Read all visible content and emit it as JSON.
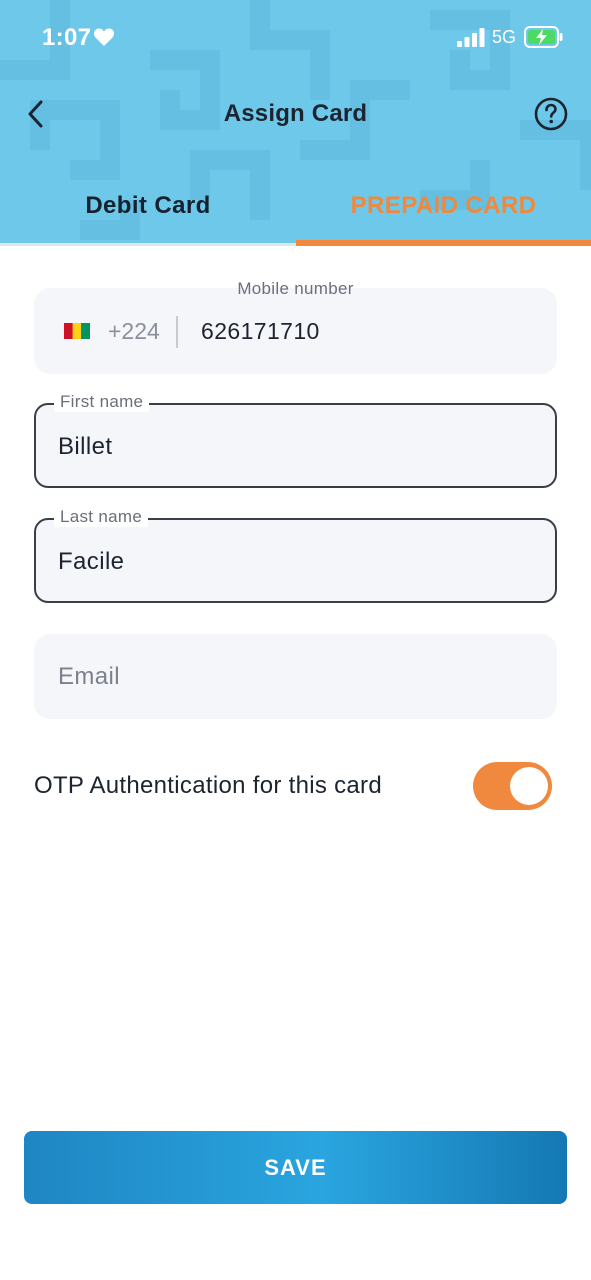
{
  "status_bar": {
    "time": "1:07",
    "network": "5G",
    "icons": [
      "heart-icon",
      "signal-icon",
      "battery-charging-icon"
    ]
  },
  "header": {
    "title": "Assign Card",
    "back_icon": "chevron-left-icon",
    "help_icon": "question-circle-icon",
    "background_color": "#6ec8ea"
  },
  "tabs": [
    {
      "label": "Debit Card",
      "active": false
    },
    {
      "label": "PREPAID CARD",
      "active": true
    }
  ],
  "form": {
    "mobile": {
      "label": "Mobile number",
      "flag_icon": "guinea-flag-icon",
      "dial_code": "+224",
      "value": "626171710"
    },
    "first_name": {
      "label": "First name",
      "value": "Billet"
    },
    "last_name": {
      "label": "Last name",
      "value": "Facile"
    },
    "email": {
      "placeholder": "Email",
      "value": ""
    }
  },
  "otp": {
    "label": "OTP Authentication for this card",
    "enabled": true
  },
  "save_button": {
    "label": "SAVE"
  },
  "colors": {
    "accent": "#f0883d",
    "primary_button": "#2aa5df",
    "text_dark": "#1c2430"
  }
}
